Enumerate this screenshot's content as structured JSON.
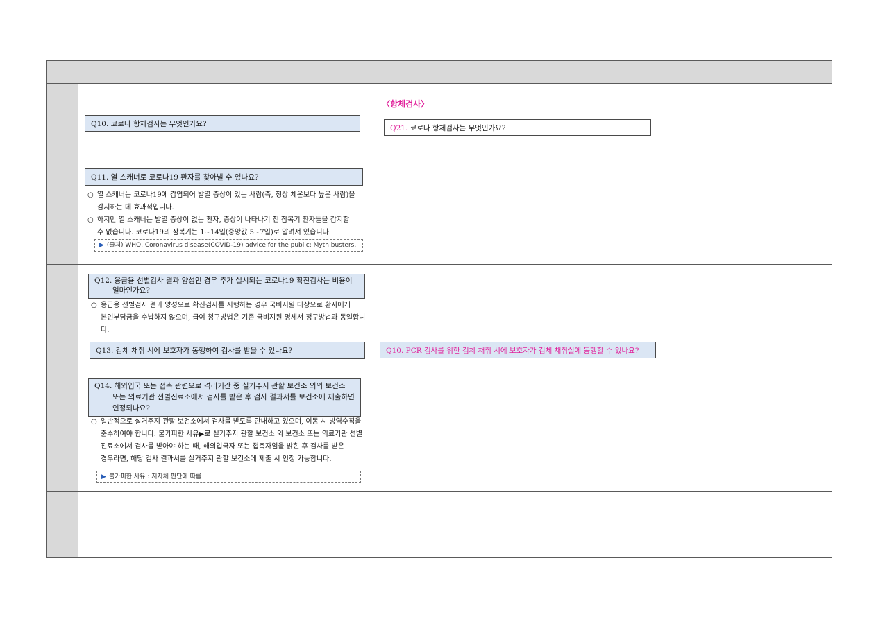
{
  "col_b": {
    "q10": "Q10. 코로나 항체검사는 무엇인가요?",
    "q11": "Q11. 열 스캐너로 코로나19 환자를 찾아낼 수 있나요?",
    "a11_1_l1": "열 스캐너는 코로나19에 감염되어 발열 증상이 있는 사람(즉, 정상 체온보다 높은 사람)을",
    "a11_1_l2": "감지하는 데 효과적입니다.",
    "a11_2_l1": "하지만 열 스캐너는 발열 증상이 없는 환자, 증상이 나타나기 전 잠복기 환자들을 감지할",
    "a11_2_l2": "수 없습니다. 코로나19의 잠복기는 1~14일(중앙값 5~7일)로 알려져 있습니다.",
    "note11": "(출처) WHO, Coronavirus disease(COVID-19) advice for the public: Myth busters.",
    "q12_l1": "Q12. 응급용 선별검사 결과 양성인 경우 추가 실시되는 코로나19 확진검사는 비용이",
    "q12_l2": "얼마인가요?",
    "a12_l1": "응급용 선별검사 결과 양성으로 확진검사를 시행하는 경우 국비지원 대상으로 환자에게",
    "a12_l2": "본인부담금을 수납하지 않으며, 급여 청구방법은 기존 국비지원 명세서 청구방법과 동일합니다.",
    "q13": "Q13. 검체 채취 시에 보호자가 동행하여 검사를 받을 수 있나요?",
    "q14_l1": "Q14. 해외입국 또는 접촉 관련으로 격리기간 중 실거주지 관할 보건소 외의 보건소",
    "q14_l2": "또는 의료기관 선별진료소에서 검사를 받은 후 검사 결과서를 보건소에 제출하면",
    "q14_l3": "인정되나요?",
    "a14_l1": "일반적으로 실거주지 관할 보건소에서 검사를 받도록 안내하고 있으며, 이동 시 방역수칙을",
    "a14_l2": "준수하여야 합니다. 불가피한 사유▶로 실거주지 관할 보건소 외 보건소 또는 의료기관 선별",
    "a14_l3": "진료소에서 검사를 받아야 하는 때, 해외입국자 또는 접촉자임을 밝힌 후 검사를 받은",
    "a14_l4": "경우라면, 해당 검사 결과서를 실거주지 관할 보건소에 제출 시 인정 가능합니다.",
    "note14": "불가피한 사유 : 지자체 판단에 따름"
  },
  "col_c": {
    "section": "〈항체검사〉",
    "q21_num": "Q21.",
    "q21_text": "코로나 항체검사는 무엇인가요?",
    "q10": "Q10. PCR 검사를 위한 검체 채취 시에 보호자가 검체 채취실에 동행할 수 있나요?"
  },
  "colors": {
    "question_fill": "#dbe6f4",
    "header_fill": "#d9d9d9",
    "accent": "#e0209a"
  }
}
